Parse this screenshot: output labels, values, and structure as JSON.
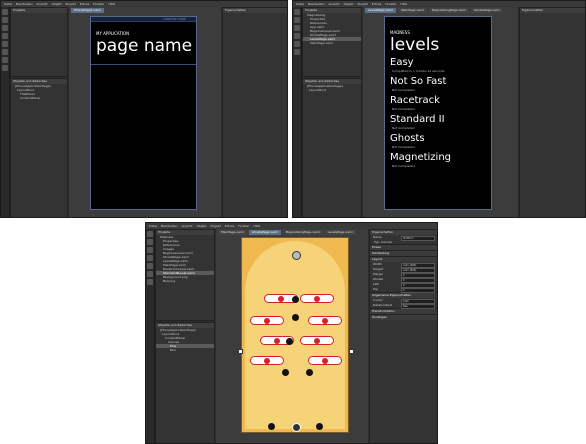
{
  "menus": [
    "Datei",
    "Bearbeiten",
    "Ansicht",
    "Objekt",
    "Projekt",
    "Extras",
    "Fenster",
    "Hilfe"
  ],
  "panels": {
    "projects": "Projekte",
    "objects": "Objekte und Zeitachse",
    "properties": "Eigenschaften",
    "resources": "Ressourcen"
  },
  "s1": {
    "tab": "PhonePage1.xaml",
    "status_text": "WINDOWS PHONE",
    "app_title": "MY APPLICATION",
    "page_title": "page name",
    "tree": [
      "[PhoneApplicationPage]",
      "LayoutRoot",
      "TitlePanel",
      "ContentPanel"
    ]
  },
  "s2": {
    "tabs": [
      "LevelsPage.xaml",
      "MainPage.xaml",
      "MagnetizingPage.xaml",
      "GhostsPage.xaml"
    ],
    "files": [
      "Magnetizing",
      "Properties",
      "References",
      "App.xaml",
      "BeginnerLevel.xaml",
      "GhostsPage.xaml",
      "LevelsPage.xaml",
      "MainPage.xaml"
    ],
    "app_title": "MADNESS",
    "page_title": "levels",
    "levels": [
      {
        "name": "Easy",
        "status": "Completed in 1 minute 12 seconds"
      },
      {
        "name": "Not So Fast",
        "status": "Not Completed"
      },
      {
        "name": "Racetrack",
        "status": "Not Completed"
      },
      {
        "name": "Standard II",
        "status": "Not Completed"
      },
      {
        "name": "Ghosts",
        "status": "Not Completed"
      },
      {
        "name": "Magnetizing",
        "status": "Not Completed"
      }
    ]
  },
  "s3": {
    "tabs": [
      "MainPage.xaml",
      "GhostsPage.xaml",
      "MagnetizingPage.xaml",
      "LevelsPage.xaml"
    ],
    "files": [
      "Madness",
      "Properties",
      "References",
      "Images",
      "BeginnerLevel.xaml",
      "GhostsPage.xaml",
      "LevelsPage.xaml",
      "MainPage.xaml",
      "RacetrackLevel.xaml",
      "StandardIILevel.xaml",
      "Background.png",
      "Ball.png"
    ],
    "tree": [
      "[PhoneApplicationPage]",
      "LayoutRoot",
      "ContentPanel",
      "Canvas",
      "Pins",
      "Ball"
    ],
    "prop_name": "Platform",
    "prop_type": "Typ: Canvas",
    "sections": [
      "Pinsel",
      "Darstellung",
      "Layout",
      "Allgemeine Eigenschaften",
      "Transformation",
      "Sonstiges"
    ],
    "layout_props": [
      {
        "k": "Width",
        "v": "Auto (480)"
      },
      {
        "k": "Height",
        "v": "Auto (800)"
      },
      {
        "k": "Margin",
        "v": "0"
      },
      {
        "k": "ZIndex",
        "v": "0"
      },
      {
        "k": "Left",
        "v": "0"
      },
      {
        "k": "Top",
        "v": "0"
      }
    ],
    "common_props": [
      {
        "k": "Cursor",
        "v": "Auto"
      },
      {
        "k": "DataContext",
        "v": "Neu"
      }
    ]
  }
}
